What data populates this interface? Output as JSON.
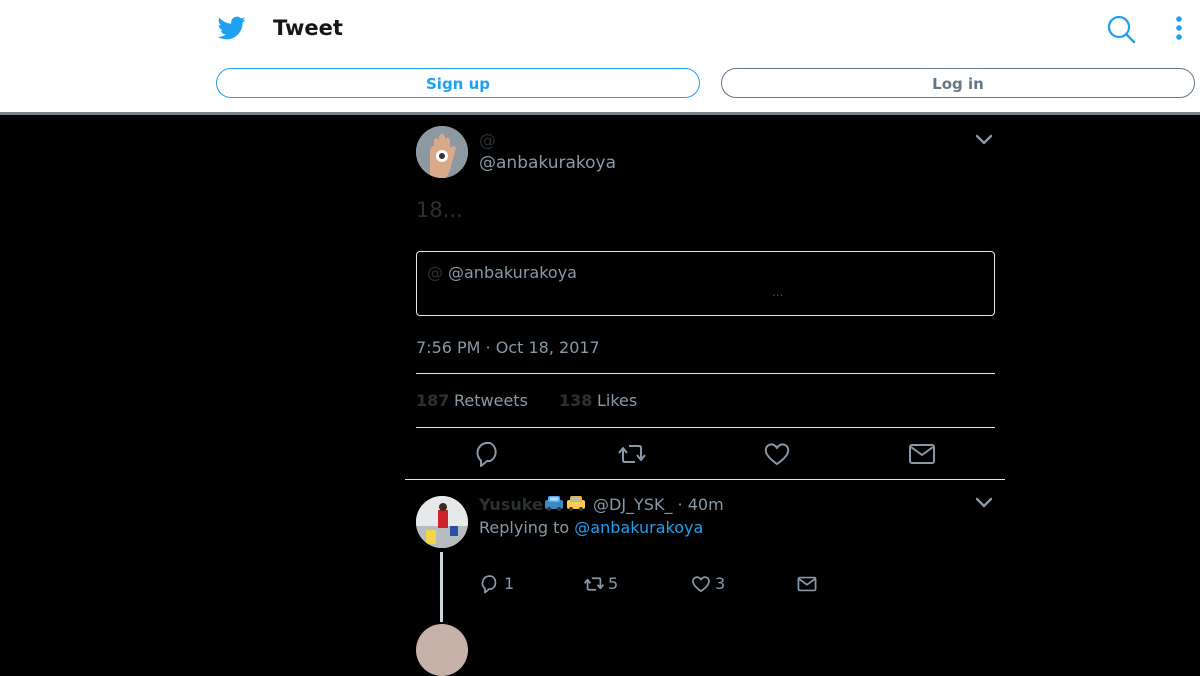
{
  "header": {
    "title": "Tweet",
    "signup_label": "Sign up",
    "login_label": "Log in",
    "brand_color": "#1da1f2"
  },
  "tweet": {
    "at_symbol": "@",
    "handle": "@anbakurakoya",
    "text": "18...",
    "quote": {
      "at_symbol": "@",
      "handle": "@anbakurakoya",
      "text": "..."
    },
    "timestamp": "7:56 PM · Oct 18, 2017",
    "retweets_count": "187",
    "retweets_label": "Retweets",
    "likes_count": "138",
    "likes_label": "Likes"
  },
  "reply": {
    "name": "Yusuke",
    "meta": "@DJ_YSK_ · 40m",
    "replying_prefix": "Replying to",
    "replying_handle": "@anbakurakoya",
    "reply_count": "1",
    "retweet_count": "5",
    "like_count": "3"
  }
}
